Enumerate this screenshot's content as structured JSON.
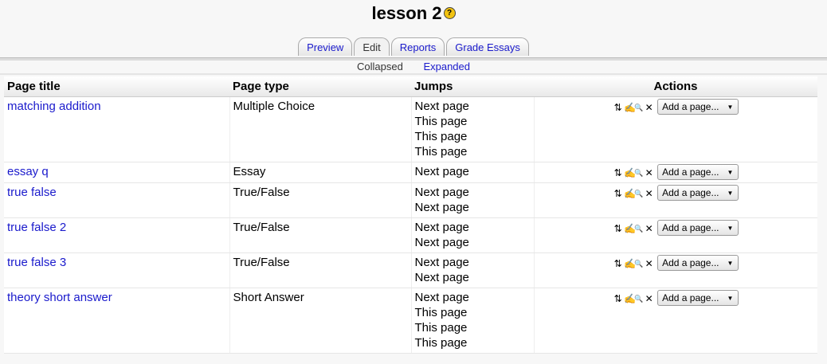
{
  "page": {
    "title": "lesson 2",
    "help_icon": "help-icon"
  },
  "tabs": [
    {
      "label": "Preview",
      "active": false
    },
    {
      "label": "Edit",
      "active": true
    },
    {
      "label": "Reports",
      "active": false
    },
    {
      "label": "Grade Essays",
      "active": false
    }
  ],
  "subtabs": {
    "collapsed": "Collapsed",
    "expanded": "Expanded"
  },
  "table": {
    "headers": {
      "title": "Page title",
      "type": "Page type",
      "jumps": "Jumps",
      "actions": "Actions"
    },
    "add_page_label": "Add a page...",
    "action_icons": [
      "move-icon",
      "edit-icon",
      "preview-icon",
      "delete-icon"
    ],
    "rows": [
      {
        "title": "matching addition",
        "type": "Multiple Choice",
        "jumps": [
          "Next page",
          "This page",
          "This page",
          "This page"
        ]
      },
      {
        "title": "essay q",
        "type": "Essay",
        "jumps": [
          "Next page"
        ]
      },
      {
        "title": "true false",
        "type": "True/False",
        "jumps": [
          "Next page",
          "Next page"
        ]
      },
      {
        "title": "true false 2",
        "type": "True/False",
        "jumps": [
          "Next page",
          "Next page"
        ]
      },
      {
        "title": "true false 3",
        "type": "True/False",
        "jumps": [
          "Next page",
          "Next page"
        ]
      },
      {
        "title": "theory short answer",
        "type": "Short Answer",
        "jumps": [
          "Next page",
          "This page",
          "This page",
          "This page"
        ]
      }
    ]
  },
  "colors": {
    "link": "#1a1acc",
    "help_icon": "#f2c311"
  }
}
